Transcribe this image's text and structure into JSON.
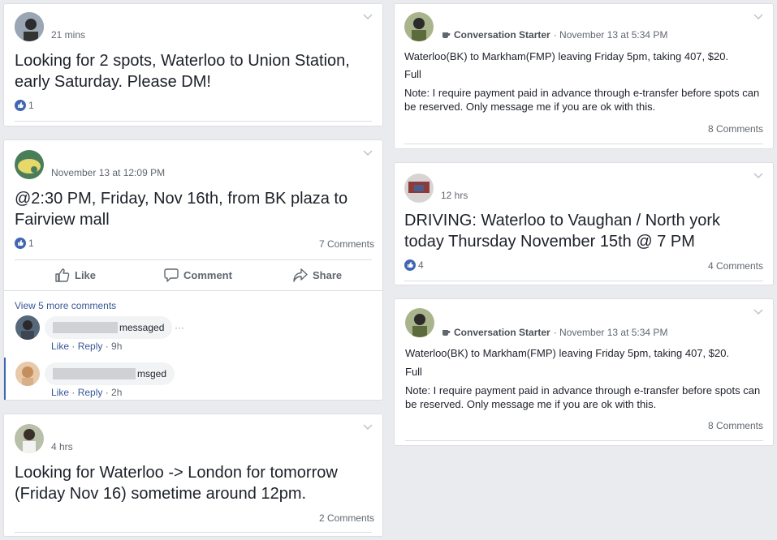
{
  "posts": {
    "p1": {
      "time": "21 mins",
      "text": "Looking for 2 spots, Waterloo to Union Station, early Saturday. Please DM!",
      "likes": "1"
    },
    "p2": {
      "time": "November 13 at 12:09 PM",
      "text": "@2:30 PM, Friday, Nov 16th, from BK plaza to Fairview mall",
      "likes": "1",
      "comments": "7 Comments",
      "actions": {
        "like": "Like",
        "comment": "Comment",
        "share": "Share"
      },
      "view_more": "View 5 more comments",
      "replies": [
        {
          "text": "messaged",
          "like": "Like",
          "reply": "Reply",
          "age": "9h",
          "more": "···"
        },
        {
          "text": "msged",
          "like": "Like",
          "reply": "Reply",
          "age": "2h"
        }
      ]
    },
    "p3": {
      "time": "4 hrs",
      "text": "Looking for Waterloo -> London for tomorrow (Friday Nov 16) sometime around 12pm.",
      "comments": "2 Comments"
    },
    "p4": {
      "badge": "Conversation Starter",
      "time": "· November 13 at 5:34 PM",
      "line1": "Waterloo(BK) to Markham(FMP) leaving Friday 5pm, taking 407, $20.",
      "line2": "Full",
      "line3": "Note: I require payment paid in advance through e-transfer before spots can be reserved. Only message me if you are ok with this.",
      "comments": "8 Comments"
    },
    "p5": {
      "time": "12 hrs",
      "text": "DRIVING: Waterloo to Vaughan / North york today Thursday November 15th @ 7 PM",
      "likes": "4",
      "comments": "4 Comments"
    },
    "p6": {
      "badge": "Conversation Starter",
      "time": "· November 13 at 5:34 PM",
      "line1": "Waterloo(BK) to Markham(FMP) leaving Friday 5pm, taking 407, $20.",
      "line2": "Full",
      "line3": "Note: I require payment paid in advance through e-transfer before spots can be reserved. Only message me if you are ok with this.",
      "comments": "8 Comments"
    }
  },
  "colors": {
    "accent": "#4267b2",
    "link": "#385898",
    "muted": "#606770"
  },
  "icons": [
    "chevron-down-icon",
    "like-thumb-icon",
    "comment-icon",
    "share-icon",
    "coffee-cup-icon"
  ]
}
